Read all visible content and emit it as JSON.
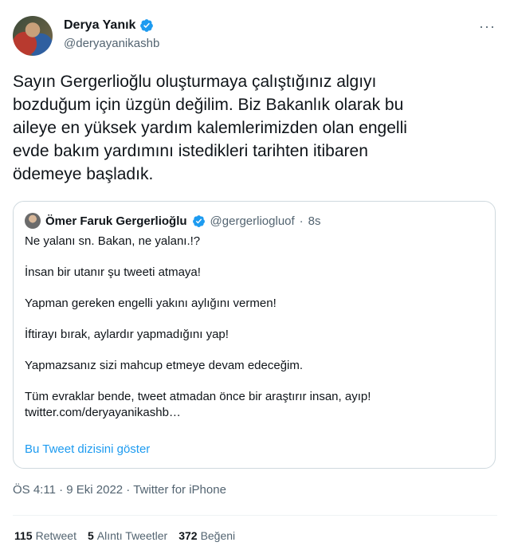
{
  "author": {
    "name": "Derya Yanık",
    "handle": "@deryayanikashb"
  },
  "more_label": "···",
  "tweet": {
    "text": "Sayın Gergerlioğlu oluşturmaya çalıştığınız algıyı\nbozduğum için üzgün değilim. Biz Bakanlık olarak bu\naileye en yüksek yardım kalemlerimizden olan engelli\nevde bakım yardımını istedikleri tarihten itibaren\nödemeye başladık."
  },
  "quoted": {
    "name": "Ömer Faruk Gergerlioğlu",
    "handle": "@gergerliogluof",
    "separator": "·",
    "time": "8s",
    "lines": [
      "Ne yalanı sn. Bakan, ne yalanı.!?",
      "",
      "İnsan bir utanır şu tweeti atmaya!",
      "",
      "Yapman gereken engelli yakını aylığını vermen!",
      "",
      "İftirayı bırak, aylardır yapmadığını yap!",
      "",
      "Yapmazsanız sizi mahcup etmeye devam edeceğim.",
      "",
      "Tüm evraklar bende, tweet atmadan önce bir araştırır insan, ayıp!",
      "twitter.com/deryayanikashb…"
    ],
    "thread_link": "Bu Tweet dizisini göster"
  },
  "meta": "ÖS 4:11 · 9 Eki 2022 · Twitter for iPhone",
  "stats": {
    "retweets_count": "115",
    "retweets_label": "Retweet",
    "quotes_count": "5",
    "quotes_label": "Alıntı Tweetler",
    "likes_count": "372",
    "likes_label": "Beğeni"
  },
  "colors": {
    "accent": "#1d9bf0",
    "secondary_text": "#536471",
    "border": "#cfd9de"
  }
}
